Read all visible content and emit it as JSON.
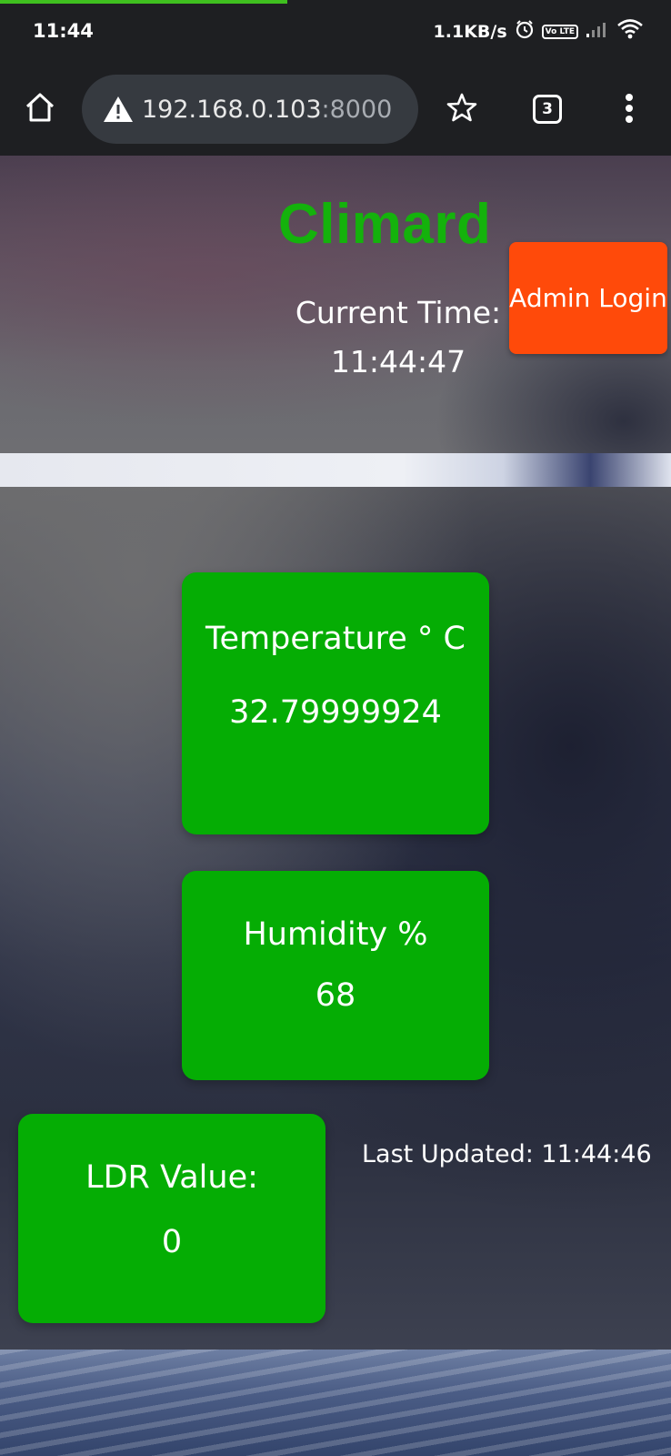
{
  "status_bar": {
    "time": "11:44",
    "net_speed": "1.1KB/s",
    "volte_label": "Vo LTE"
  },
  "browser": {
    "url_host": "192.168.0.103",
    "url_port": ":8000",
    "tab_count": "3",
    "icons": [
      "home-icon",
      "warning-icon",
      "star-icon",
      "tabs-icon",
      "overflow-menu-icon"
    ]
  },
  "page": {
    "title": "Climard",
    "current_time_label": "Current Time:",
    "current_time_value": "11:44:47",
    "admin_button": "Admin Login",
    "colors": {
      "accent_green": "#05ad04",
      "title_green": "#14b20c",
      "admin_orange": "#ff4a0a"
    }
  },
  "cards": {
    "temperature": {
      "label": "Temperature ° C",
      "value": "32.79999924"
    },
    "humidity": {
      "label": "Humidity %",
      "value": "68"
    },
    "ldr": {
      "label": "LDR Value:",
      "value": "0"
    }
  },
  "last_updated": "Last Updated: 11:44:46"
}
